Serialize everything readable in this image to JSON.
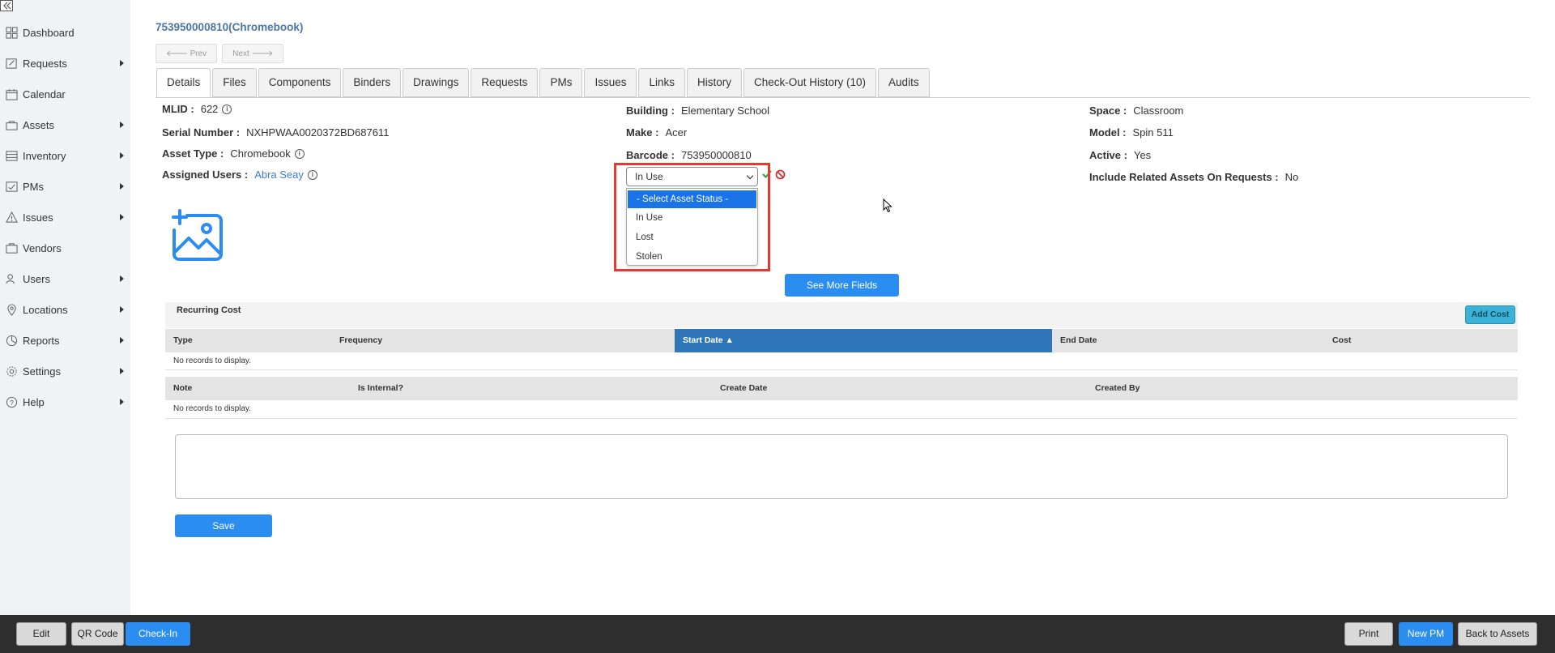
{
  "sidebar": {
    "items": [
      {
        "label": "Dashboard",
        "icon": "dashboard-icon",
        "has_submenu": false
      },
      {
        "label": "Requests",
        "icon": "requests-icon",
        "has_submenu": true
      },
      {
        "label": "Calendar",
        "icon": "calendar-icon",
        "has_submenu": false
      },
      {
        "label": "Assets",
        "icon": "assets-icon",
        "has_submenu": true
      },
      {
        "label": "Inventory",
        "icon": "inventory-icon",
        "has_submenu": true
      },
      {
        "label": "PMs",
        "icon": "pms-icon",
        "has_submenu": true
      },
      {
        "label": "Issues",
        "icon": "warning-icon",
        "has_submenu": true
      },
      {
        "label": "Vendors",
        "icon": "vendors-icon",
        "has_submenu": false
      },
      {
        "label": "Users",
        "icon": "users-icon",
        "has_submenu": true
      },
      {
        "label": "Locations",
        "icon": "location-icon",
        "has_submenu": true
      },
      {
        "label": "Reports",
        "icon": "reports-icon",
        "has_submenu": true
      },
      {
        "label": "Settings",
        "icon": "gear-icon",
        "has_submenu": true
      },
      {
        "label": "Help",
        "icon": "help-icon",
        "has_submenu": true
      }
    ]
  },
  "header": {
    "title": "753950000810(Chromebook)",
    "prev_label": "🡐 Prev",
    "next_label": "Next 🡒"
  },
  "tabs": [
    {
      "label": "Details",
      "active": true
    },
    {
      "label": "Files"
    },
    {
      "label": "Components"
    },
    {
      "label": "Binders"
    },
    {
      "label": "Drawings"
    },
    {
      "label": "Requests"
    },
    {
      "label": "PMs"
    },
    {
      "label": "Issues"
    },
    {
      "label": "Links"
    },
    {
      "label": "History"
    },
    {
      "label": "Check-Out History (10)"
    },
    {
      "label": "Audits"
    }
  ],
  "details": {
    "mlid": {
      "label": "MLID :",
      "value": "622"
    },
    "serial": {
      "label": "Serial Number :",
      "value": "NXHPWAA0020372BD687611"
    },
    "asset_type": {
      "label": "Asset Type :",
      "value": "Chromebook"
    },
    "assigned_users": {
      "label": "Assigned Users :",
      "value": "Abra Seay"
    },
    "building": {
      "label": "Building :",
      "value": "Elementary School"
    },
    "make": {
      "label": "Make :",
      "value": "Acer"
    },
    "barcode": {
      "label": "Barcode :",
      "value": "753950000810"
    },
    "space": {
      "label": "Space :",
      "value": "Classroom"
    },
    "model": {
      "label": "Model :",
      "value": "Spin 511"
    },
    "active": {
      "label": "Active :",
      "value": "Yes"
    },
    "include_related": {
      "label": "Include Related Assets On Requests :",
      "value": "No"
    }
  },
  "status": {
    "current": "In Use",
    "options": [
      "- Select Asset Status -",
      "In Use",
      "Lost",
      "Stolen"
    ],
    "highlighted": "- Select Asset Status -",
    "highlight_color": "#e53935"
  },
  "see_more_label": "See More Fields",
  "recurring_cost": {
    "title": "Recurring Cost",
    "add_label": "Add Cost",
    "columns": [
      "Type",
      "Frequency",
      "Start Date ▲",
      "End Date",
      "Cost"
    ],
    "sorted_column": "Start Date",
    "empty_text": "No records to display."
  },
  "notes": {
    "columns": [
      "Note",
      "Is Internal?",
      "Create Date",
      "Created By"
    ],
    "empty_text": "No records to display.",
    "note_value": ""
  },
  "save_label": "Save",
  "footer": {
    "edit_label": "Edit",
    "qr_label": "QR Code",
    "checkin_label": "Check-In",
    "print_label": "Print",
    "new_pm_label": "New PM",
    "back_label": "Back to Assets"
  },
  "colors": {
    "accent": "#2b8df0",
    "sorted_header": "#2f76b8",
    "title": "#4a76a8",
    "footer_bg": "#2e2e2e"
  }
}
